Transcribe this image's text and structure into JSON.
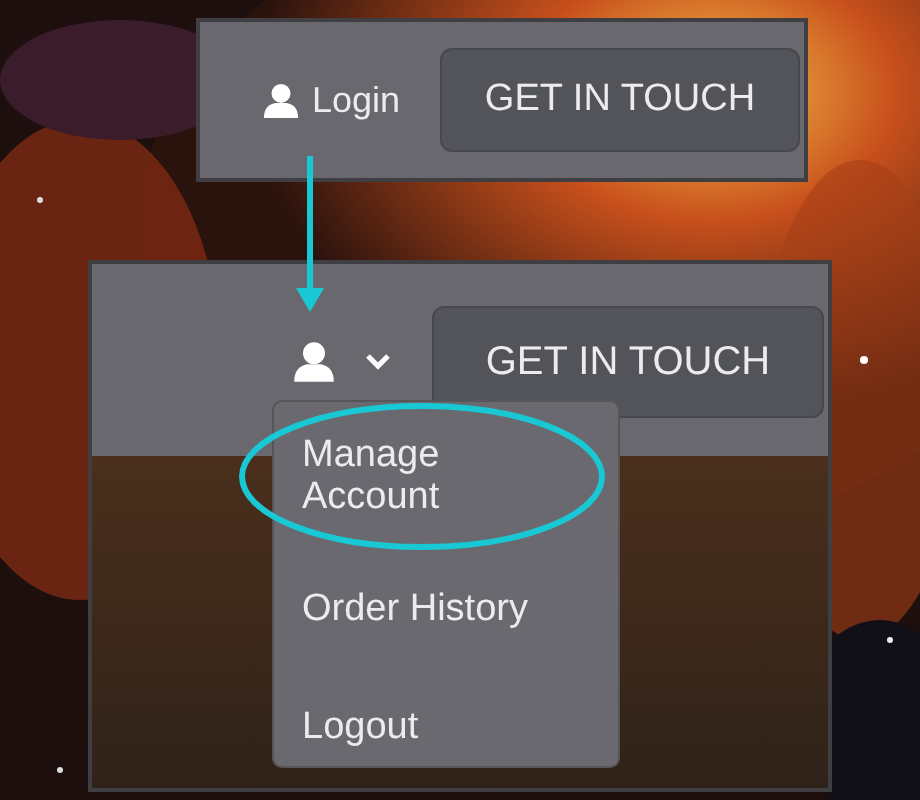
{
  "before": {
    "login_label": "Login",
    "button": "GET IN TOUCH"
  },
  "after": {
    "button": "GET IN TOUCH",
    "menu_expanded": true,
    "menu": [
      {
        "label": "Manage Account",
        "highlighted": true
      },
      {
        "label": "Order History",
        "highlighted": false
      },
      {
        "label": "Logout",
        "highlighted": false
      }
    ]
  }
}
